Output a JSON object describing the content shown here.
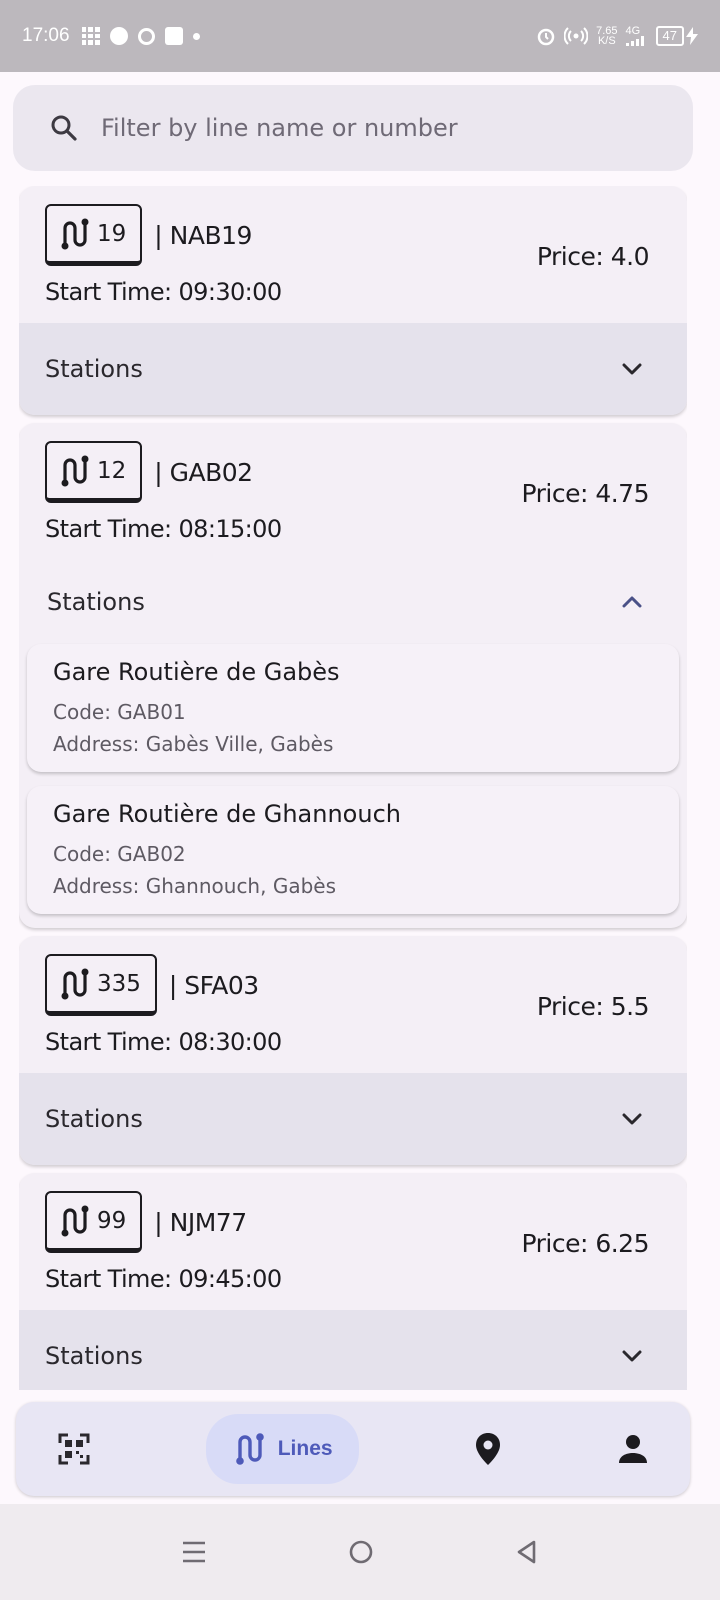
{
  "status_bar": {
    "time": "17:06",
    "speed": "7.65",
    "speed_unit": "K/S",
    "network": "4G",
    "battery": "47"
  },
  "search": {
    "placeholder": "Filter by line name or number"
  },
  "lines": [
    {
      "number": "19",
      "code": "| NAB19",
      "price": "Price: 4.0",
      "start_time": "Start Time: 09:30:00",
      "stations_label": "Stations",
      "expanded": false
    },
    {
      "number": "12",
      "code": "| GAB02",
      "price": "Price: 4.75",
      "start_time": "Start Time: 08:15:00",
      "stations_label": "Stations",
      "expanded": true,
      "stations": [
        {
          "name": "Gare Routière de Gabès",
          "code": "Code: GAB01",
          "address": "Address: Gabès Ville, Gabès"
        },
        {
          "name": "Gare Routière de Ghannouch",
          "code": "Code: GAB02",
          "address": "Address: Ghannouch, Gabès"
        }
      ]
    },
    {
      "number": "335",
      "code": "| SFA03",
      "price": "Price: 5.5",
      "start_time": "Start Time: 08:30:00",
      "stations_label": "Stations",
      "expanded": false
    },
    {
      "number": "99",
      "code": "| NJM77",
      "price": "Price: 6.25",
      "start_time": "Start Time: 09:45:00",
      "stations_label": "Stations",
      "expanded": false
    }
  ],
  "bottom_nav": {
    "items": [
      {
        "icon": "qr-scan-icon"
      },
      {
        "icon": "route-icon",
        "label": "Lines",
        "active": true
      },
      {
        "icon": "location-pin-icon"
      },
      {
        "icon": "person-icon"
      }
    ]
  },
  "colors": {
    "accent": "#4e5ab9",
    "nav_active_bg": "#d8dbf7",
    "card_bg": "#f4eff6",
    "stations_bar": "#e5e2ec"
  }
}
